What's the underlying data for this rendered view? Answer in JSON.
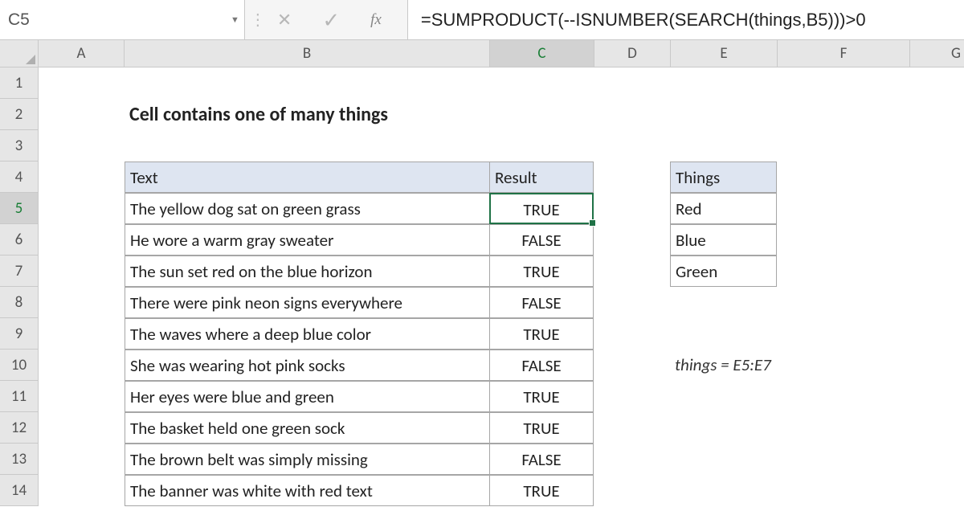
{
  "name_box": "C5",
  "formula": "=SUMPRODUCT(--ISNUMBER(SEARCH(things,B5)))>0",
  "columns": [
    "A",
    "B",
    "C",
    "D",
    "E",
    "F",
    "G"
  ],
  "rows": [
    "1",
    "2",
    "3",
    "4",
    "5",
    "6",
    "7",
    "8",
    "9",
    "10",
    "11",
    "12",
    "13",
    "14"
  ],
  "active_col": "C",
  "active_row": "5",
  "title": "Cell contains one of many things",
  "headers": {
    "text": "Text",
    "result": "Result",
    "things": "Things"
  },
  "table": [
    {
      "text": "The yellow dog sat on green grass",
      "result": "TRUE"
    },
    {
      "text": "He wore a warm gray sweater",
      "result": "FALSE"
    },
    {
      "text": "The sun set red on the blue horizon",
      "result": "TRUE"
    },
    {
      "text": "There were pink neon signs everywhere",
      "result": "FALSE"
    },
    {
      "text": "The waves where a deep blue color",
      "result": "TRUE"
    },
    {
      "text": "She was wearing hot pink socks",
      "result": "FALSE"
    },
    {
      "text": "Her eyes were blue and green",
      "result": "TRUE"
    },
    {
      "text": "The basket held one green sock",
      "result": "TRUE"
    },
    {
      "text": "The brown belt was simply missing",
      "result": "FALSE"
    },
    {
      "text": "The banner was white with red text",
      "result": "TRUE"
    }
  ],
  "things": [
    "Red",
    "Blue",
    "Green"
  ],
  "note": "things = E5:E7"
}
